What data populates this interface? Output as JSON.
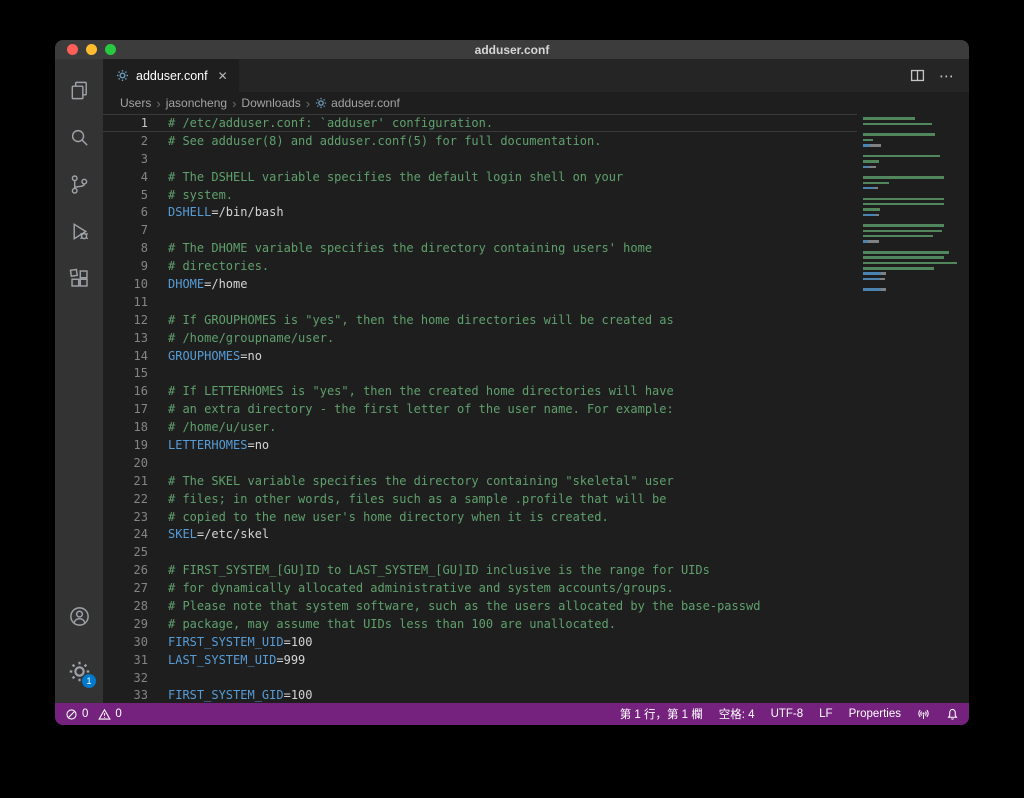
{
  "window": {
    "title": "adduser.conf"
  },
  "tabbar": {
    "tab_label": "adduser.conf"
  },
  "icons": {
    "close": "✕",
    "ellipsis": "⋯",
    "breadcrumb_separator": "›"
  },
  "breadcrumb": [
    "Users",
    "jasoncheng",
    "Downloads",
    "adduser.conf"
  ],
  "activitybar": {
    "badge": "1"
  },
  "colors": {
    "statusbar": "#75227f",
    "accent": "#007acc",
    "comment": "#5fa06c",
    "key": "#569cd6",
    "plain": "#d4d4d4",
    "close_red": "#ff5f57",
    "min_yellow": "#febc2e",
    "zoom_green": "#28c840"
  },
  "code": {
    "lines": [
      {
        "parts": [
          {
            "c": "comment",
            "t": "# /etc/adduser.conf: `adduser' configuration."
          }
        ]
      },
      {
        "parts": [
          {
            "c": "comment",
            "t": "# See adduser(8) and adduser.conf(5) for full documentation."
          }
        ]
      },
      {
        "parts": []
      },
      {
        "parts": [
          {
            "c": "comment",
            "t": "# The DSHELL variable specifies the default login shell on your"
          }
        ]
      },
      {
        "parts": [
          {
            "c": "comment",
            "t": "# system."
          }
        ]
      },
      {
        "parts": [
          {
            "c": "key",
            "t": "DSHELL"
          },
          {
            "c": "plain",
            "t": "=/bin/bash"
          }
        ]
      },
      {
        "parts": []
      },
      {
        "parts": [
          {
            "c": "comment",
            "t": "# The DHOME variable specifies the directory containing users' home"
          }
        ]
      },
      {
        "parts": [
          {
            "c": "comment",
            "t": "# directories."
          }
        ]
      },
      {
        "parts": [
          {
            "c": "key",
            "t": "DHOME"
          },
          {
            "c": "plain",
            "t": "=/home"
          }
        ]
      },
      {
        "parts": []
      },
      {
        "parts": [
          {
            "c": "comment",
            "t": "# If GROUPHOMES is \"yes\", then the home directories will be created as"
          }
        ]
      },
      {
        "parts": [
          {
            "c": "comment",
            "t": "# /home/groupname/user."
          }
        ]
      },
      {
        "parts": [
          {
            "c": "key",
            "t": "GROUPHOMES"
          },
          {
            "c": "plain",
            "t": "=no"
          }
        ]
      },
      {
        "parts": []
      },
      {
        "parts": [
          {
            "c": "comment",
            "t": "# If LETTERHOMES is \"yes\", then the created home directories will have"
          }
        ]
      },
      {
        "parts": [
          {
            "c": "comment",
            "t": "# an extra directory - the first letter of the user name. For example:"
          }
        ]
      },
      {
        "parts": [
          {
            "c": "comment",
            "t": "# /home/u/user."
          }
        ]
      },
      {
        "parts": [
          {
            "c": "key",
            "t": "LETTERHOMES"
          },
          {
            "c": "plain",
            "t": "=no"
          }
        ]
      },
      {
        "parts": []
      },
      {
        "parts": [
          {
            "c": "comment",
            "t": "# The SKEL variable specifies the directory containing \"skeletal\" user"
          }
        ]
      },
      {
        "parts": [
          {
            "c": "comment",
            "t": "# files; in other words, files such as a sample .profile that will be"
          }
        ]
      },
      {
        "parts": [
          {
            "c": "comment",
            "t": "# copied to the new user's home directory when it is created."
          }
        ]
      },
      {
        "parts": [
          {
            "c": "key",
            "t": "SKEL"
          },
          {
            "c": "plain",
            "t": "=/etc/skel"
          }
        ]
      },
      {
        "parts": []
      },
      {
        "parts": [
          {
            "c": "comment",
            "t": "# FIRST_SYSTEM_[GU]ID to LAST_SYSTEM_[GU]ID inclusive is the range for UIDs"
          }
        ]
      },
      {
        "parts": [
          {
            "c": "comment",
            "t": "# for dynamically allocated administrative and system accounts/groups."
          }
        ]
      },
      {
        "parts": [
          {
            "c": "comment",
            "t": "# Please note that system software, such as the users allocated by the base-passwd"
          }
        ]
      },
      {
        "parts": [
          {
            "c": "comment",
            "t": "# package, may assume that UIDs less than 100 are unallocated."
          }
        ]
      },
      {
        "parts": [
          {
            "c": "key",
            "t": "FIRST_SYSTEM_UID"
          },
          {
            "c": "plain",
            "t": "=100"
          }
        ]
      },
      {
        "parts": [
          {
            "c": "key",
            "t": "LAST_SYSTEM_UID"
          },
          {
            "c": "plain",
            "t": "=999"
          }
        ]
      },
      {
        "parts": []
      },
      {
        "parts": [
          {
            "c": "key",
            "t": "FIRST_SYSTEM_GID"
          },
          {
            "c": "plain",
            "t": "=100"
          }
        ]
      }
    ]
  },
  "statusbar": {
    "errors": "0",
    "warnings": "0",
    "cursor": "第 1 行，第 1 欄",
    "spaces": "空格: 4",
    "encoding": "UTF-8",
    "eol": "LF",
    "language": "Properties"
  }
}
